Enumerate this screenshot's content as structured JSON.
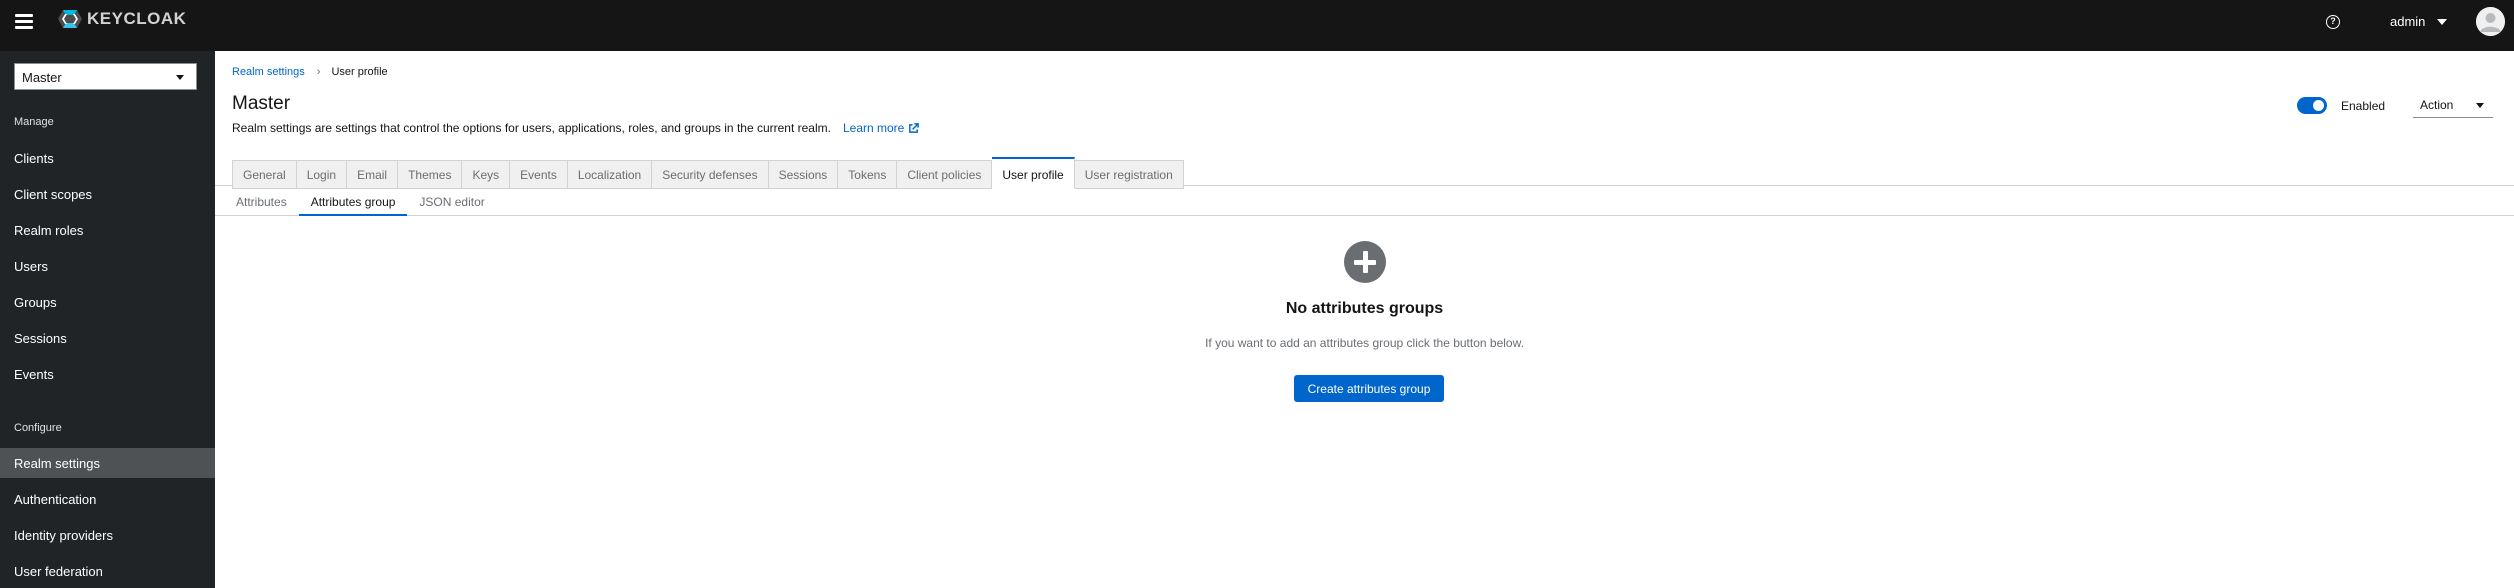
{
  "masthead": {
    "logo_text": "KEYCLOAK",
    "help_icon": "help-circle-icon",
    "user_name": "admin"
  },
  "sidebar": {
    "realm_selected": "Master",
    "sections": {
      "manage": "Manage",
      "configure": "Configure"
    },
    "manage_items": [
      {
        "label": "Clients"
      },
      {
        "label": "Client scopes"
      },
      {
        "label": "Realm roles"
      },
      {
        "label": "Users"
      },
      {
        "label": "Groups"
      },
      {
        "label": "Sessions"
      },
      {
        "label": "Events"
      }
    ],
    "configure_items": [
      {
        "label": "Realm settings",
        "active": true
      },
      {
        "label": "Authentication"
      },
      {
        "label": "Identity providers"
      },
      {
        "label": "User federation"
      }
    ]
  },
  "breadcrumb": {
    "parent": "Realm settings",
    "current": "User profile"
  },
  "page": {
    "title": "Master",
    "description": "Realm settings are settings that control the options for users, applications, roles, and groups in the current realm.",
    "learn_more": "Learn more",
    "enabled_label": "Enabled",
    "enabled": true,
    "action_label": "Action"
  },
  "tabs": [
    {
      "label": "General"
    },
    {
      "label": "Login"
    },
    {
      "label": "Email"
    },
    {
      "label": "Themes"
    },
    {
      "label": "Keys"
    },
    {
      "label": "Events"
    },
    {
      "label": "Localization"
    },
    {
      "label": "Security defenses"
    },
    {
      "label": "Sessions"
    },
    {
      "label": "Tokens"
    },
    {
      "label": "Client policies"
    },
    {
      "label": "User profile",
      "active": true
    },
    {
      "label": "User registration"
    }
  ],
  "subtabs": [
    {
      "label": "Attributes"
    },
    {
      "label": "Attributes group",
      "active": true
    },
    {
      "label": "JSON editor"
    }
  ],
  "empty_state": {
    "icon": "plus-circle-icon",
    "title": "No attributes groups",
    "body": "If you want to add an attributes group click the button below.",
    "button": "Create attributes group"
  },
  "colors": {
    "accent": "#0066cc",
    "masthead": "#151515",
    "sidebar": "#212427"
  }
}
